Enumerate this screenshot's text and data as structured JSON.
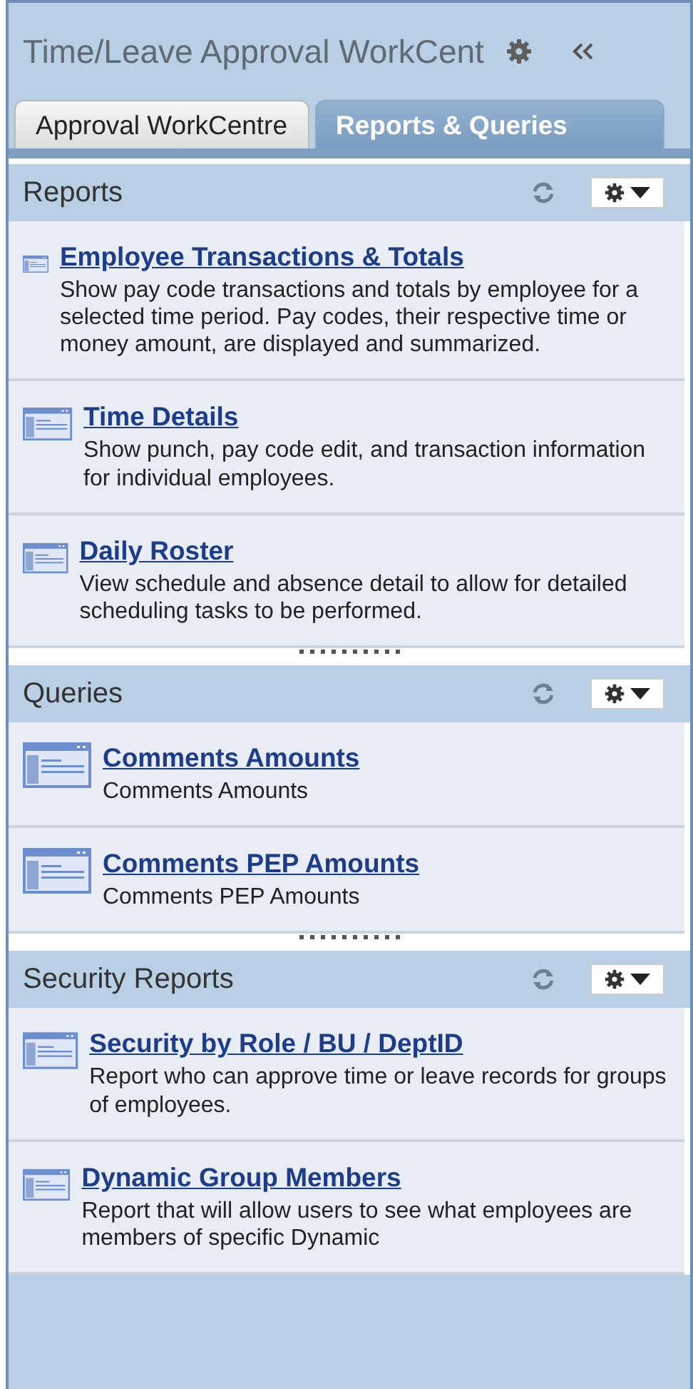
{
  "header": {
    "title": "Time/Leave Approval WorkCent"
  },
  "tabs": [
    {
      "label": "Approval WorkCentre",
      "selected": false
    },
    {
      "label": "Reports & Queries",
      "selected": true
    }
  ],
  "sections": [
    {
      "title": "Reports",
      "items": [
        {
          "title": "Employee Transactions & Totals",
          "description": "Show pay code transactions and totals by employee for a selected time period. Pay codes, their respective time or money amount, are displayed and summarized."
        },
        {
          "title": "Time Details",
          "description": "Show punch, pay code edit, and transaction information for individual employees."
        },
        {
          "title": "Daily Roster",
          "description": "View schedule and absence detail to allow for detailed scheduling tasks to be performed."
        }
      ]
    },
    {
      "title": "Queries",
      "items": [
        {
          "title": "Comments Amounts",
          "description": "Comments Amounts"
        },
        {
          "title": "Comments PEP Amounts",
          "description": "Comments PEP Amounts"
        }
      ]
    },
    {
      "title": "Security Reports",
      "items": [
        {
          "title": "Security by Role / BU / DeptID",
          "description": "Report who can approve time or leave records for groups of employees."
        },
        {
          "title": "Dynamic Group Members",
          "description": "Report that will allow users to see what employees are members of specific Dynamic"
        }
      ]
    }
  ]
}
